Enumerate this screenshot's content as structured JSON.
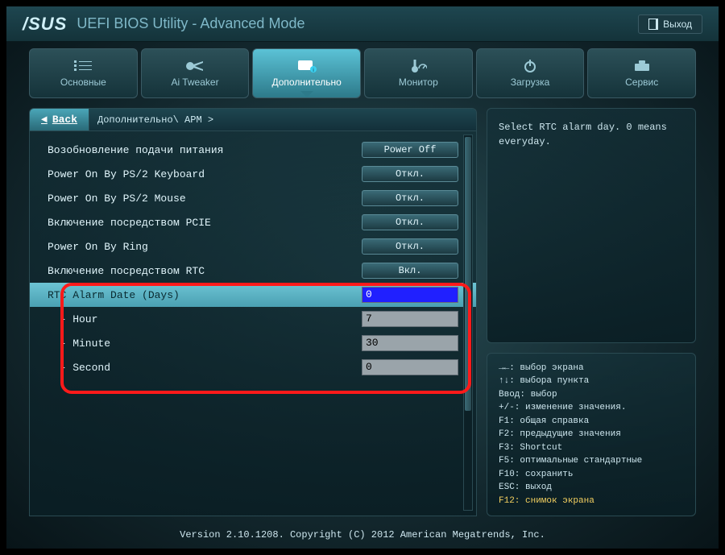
{
  "header": {
    "logo": "/SUS",
    "title": "UEFI BIOS Utility - Advanced Mode",
    "exit_label": "Выход"
  },
  "tabs": [
    {
      "label": "Основные"
    },
    {
      "label": "Ai Tweaker"
    },
    {
      "label": "Дополнительно"
    },
    {
      "label": "Монитор"
    },
    {
      "label": "Загрузка"
    },
    {
      "label": "Сервис"
    }
  ],
  "breadcrumb": {
    "back_label": "Back",
    "path": "Дополнительно\\ APM  >"
  },
  "settings": [
    {
      "label": "Возобновление подачи питания",
      "type": "dropdown",
      "value": "Power Off"
    },
    {
      "label": "Power On By PS/2 Keyboard",
      "type": "dropdown",
      "value": "Откл."
    },
    {
      "label": "Power On By PS/2 Mouse",
      "type": "dropdown",
      "value": "Откл."
    },
    {
      "label": "Включение посредством PCIE",
      "type": "dropdown",
      "value": "Откл."
    },
    {
      "label": "Power On By Ring",
      "type": "dropdown",
      "value": "Откл."
    },
    {
      "label": "Включение посредством RTC",
      "type": "dropdown",
      "value": "Вкл."
    },
    {
      "label": "RTC Alarm Date (Days)",
      "type": "input",
      "value": "0",
      "highlighted": true,
      "selected": true
    },
    {
      "label": "  - Hour",
      "type": "input",
      "value": "7"
    },
    {
      "label": "  - Minute",
      "type": "input",
      "value": "30"
    },
    {
      "label": "  - Second",
      "type": "input",
      "value": "0"
    }
  ],
  "help": {
    "text": "Select RTC alarm day. 0 means everyday."
  },
  "keys": [
    {
      "text": "→←: выбор экрана"
    },
    {
      "text": "↑↓: выбора пункта"
    },
    {
      "text": "Ввод: выбор"
    },
    {
      "text": "+/-: изменение значения."
    },
    {
      "text": "F1: общая справка"
    },
    {
      "text": "F2: предыдущие значения"
    },
    {
      "text": "F3: Shortcut"
    },
    {
      "text": "F5: оптимальные стандартные"
    },
    {
      "text": "F10: сохранить"
    },
    {
      "text": "ESC: выход"
    },
    {
      "text": "F12: снимок экрана",
      "gold": true
    }
  ],
  "footer": "Version 2.10.1208. Copyright (C) 2012 American Megatrends, Inc."
}
